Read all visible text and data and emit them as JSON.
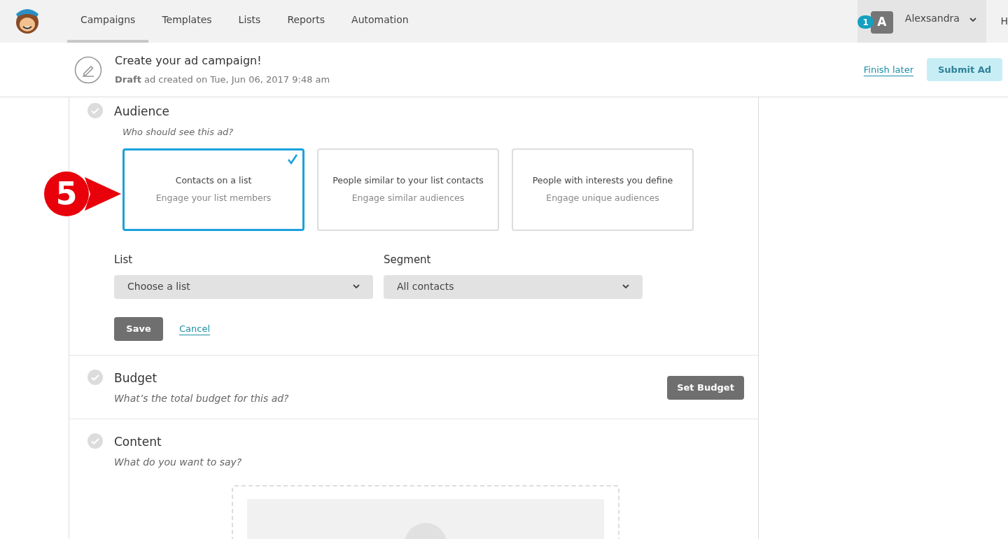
{
  "nav": {
    "tabs": [
      {
        "label": "Campaigns",
        "selected": true
      },
      {
        "label": "Templates",
        "selected": false
      },
      {
        "label": "Lists",
        "selected": false
      },
      {
        "label": "Reports",
        "selected": false
      },
      {
        "label": "Automation",
        "selected": false
      }
    ],
    "notification_count": "1",
    "avatar_letter": "A",
    "user_name": "Alexsandra",
    "cut_item": "H"
  },
  "header": {
    "title": "Create your ad campaign!",
    "status": "**Draft** ad created on Tue, Jun 06, 2017 9:48 am",
    "finish_link": "Finish later",
    "submit_button": {
      "label": "Submit Ad",
      "disabled": true
    }
  },
  "callout": {
    "number": "5"
  },
  "audience": {
    "title": "Audience",
    "question": "Who should see this ad?",
    "options": [
      {
        "title": "Contacts on a list",
        "subtitle": "Engage your list members",
        "selected": true
      },
      {
        "title": "People similar to your list contacts",
        "subtitle": "Engage similar audiences",
        "selected": false
      },
      {
        "title": "People with interests you define",
        "subtitle": "Engage unique audiences",
        "selected": false
      }
    ],
    "fields": [
      {
        "label": "List",
        "value": "Choose a list"
      },
      {
        "label": "Segment",
        "value": "All contacts"
      }
    ],
    "save": "Save",
    "cancel": "Cancel"
  },
  "sections": [
    {
      "title": "Budget",
      "question": "What’s the total budget for this ad?",
      "button": "Set Budget",
      "kind": "button"
    },
    {
      "title": "Content",
      "question": "What do you want to say?",
      "kind": "preview"
    }
  ]
}
